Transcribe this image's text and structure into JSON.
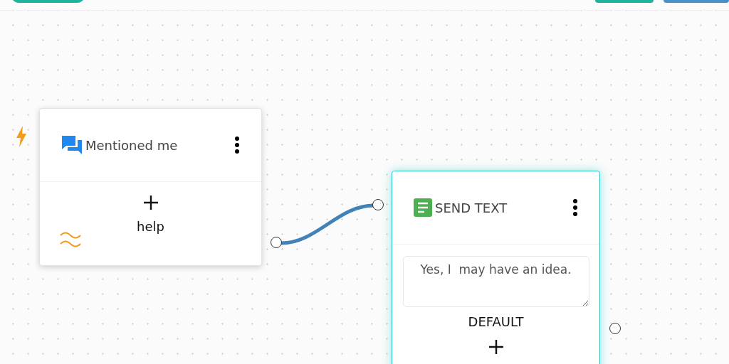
{
  "toolbar": {
    "left_buttons": [
      {
        "kind": "pill"
      }
    ],
    "right_buttons": [
      {
        "kind": "teal"
      },
      {
        "kind": "blue"
      }
    ]
  },
  "nodes": [
    {
      "kind": "trigger",
      "title": "Mentioned me",
      "selected": false,
      "actions": [
        {
          "label": "help"
        }
      ]
    },
    {
      "kind": "send_text",
      "title": "SEND TEXT",
      "selected": true,
      "message": "Yes, I  may have an idea.",
      "actions": [
        {
          "label": "DEFAULT"
        }
      ]
    }
  ]
}
